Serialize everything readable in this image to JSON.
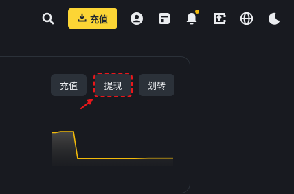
{
  "header": {
    "deposit_label": "充值",
    "icons": [
      "search-icon",
      "download-icon",
      "account-icon",
      "orders-icon",
      "notification-icon",
      "transfer-icon",
      "globe-icon",
      "theme-moon-icon"
    ],
    "notification_badge_color": "#f0b90b",
    "accent_color": "#fcd535"
  },
  "card": {
    "actions": [
      {
        "label": "充值"
      },
      {
        "label": "提现"
      },
      {
        "label": "划转"
      }
    ],
    "highlighted_action": "提现",
    "highlight_color": "#e8171b",
    "chart_color": "#f0b90b"
  },
  "chart_data": {
    "type": "area",
    "title": "",
    "xlabel": "",
    "ylabel": "",
    "x": [
      0,
      1,
      2,
      3,
      4,
      5,
      6,
      7,
      8,
      9,
      10,
      11,
      12
    ],
    "values": [
      0.92,
      0.92,
      0.95,
      0.95,
      0.95,
      0.02,
      0.02,
      0.02,
      0.02,
      0.02,
      0.03,
      0.03,
      0.03
    ],
    "grid": false
  }
}
